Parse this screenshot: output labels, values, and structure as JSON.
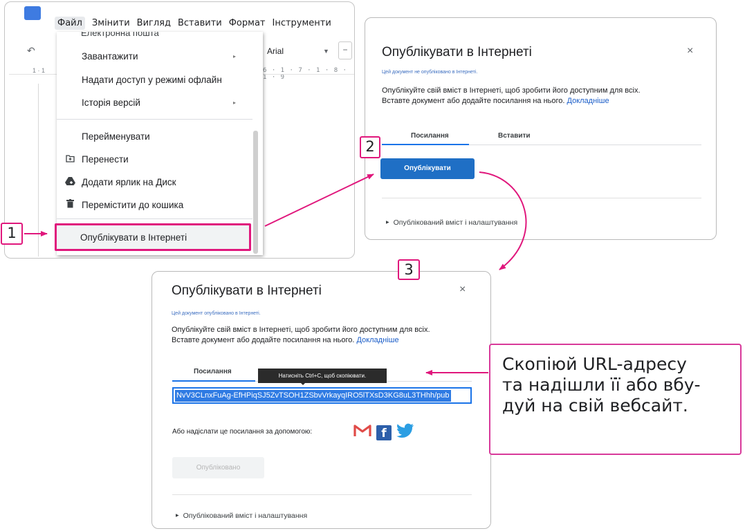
{
  "panel1": {
    "menubar": [
      "Файл",
      "Змінити",
      "Вигляд",
      "Вставити",
      "Формат",
      "Інструменти"
    ],
    "toolbar": {
      "font": "Arial",
      "zoom_minus": "−"
    },
    "ruler": "6 · 1 · 7 · 1 · 8 · 1 · 9",
    "ruler_left": "1 · 1",
    "menu_cut_item": "Електронна пошта",
    "menu_items": [
      {
        "label": "Завантажити",
        "submenu": "▸"
      },
      {
        "label": "Надати доступ у режимі офлайн"
      },
      {
        "label": "Історія версій",
        "submenu": "▸"
      },
      {
        "label": "Перейменувати"
      },
      {
        "label": "Перенести",
        "icon": "folder-move-icon"
      },
      {
        "label": "Додати ярлик на Диск",
        "icon": "drive-shortcut-icon"
      },
      {
        "label": "Перемістити до кошика",
        "icon": "trash-icon"
      }
    ],
    "publish_item": "Опублікувати в Інтернеті",
    "step": "1"
  },
  "panel2": {
    "title": "Опублікувати в Інтернеті",
    "close": "×",
    "status": "Цей документ не опубліковано в Інтернеті.",
    "desc_line1": "Опублікуйте свій вміст в Інтернеті, щоб зробити його доступним для всіх.",
    "desc_line2": "Вставте документ або додайте посилання на нього.",
    "learn_more": "Докладніше",
    "tab_link": "Посилання",
    "tab_embed": "Вставити",
    "publish_button": "Опублікувати",
    "expander": "Опублікований вміст і налаштування",
    "step": "2"
  },
  "panel3": {
    "title": "Опублікувати в Інтернеті",
    "close": "×",
    "status": "Цей документ опубліковано в Інтернеті.",
    "desc_line1": "Опублікуйте свій вміст в Інтернеті, щоб зробити його доступним для всіх.",
    "desc_line2": "Вставте документ або додайте посилання на нього.",
    "learn_more": "Докладніше",
    "tab_link": "Посилання",
    "tooltip": "Натисніть Ctrl+C, щоб скопіювати.",
    "url": "NvV3CLnxFuAg-EfHPiqSJ5ZvTSOH1ZSbvVrkayqIRO5lTXsD3KG8uL3THhh/pub",
    "share_label": "Або надіслати це посилання за допомогою:",
    "share_icons": [
      "gmail-icon",
      "facebook-icon",
      "twitter-icon"
    ],
    "published_button": "Опубліковано",
    "expander": "Опублікований вміст і налаштування",
    "step": "3"
  },
  "callout": {
    "text": "Скопіюй URL-адресу\nта надішли її або вбу-\nдуй на свій вебсайт."
  },
  "colors": {
    "highlight": "#e0177c",
    "publish_button": "#1f6fc5",
    "link": "#1a5dc8",
    "tab_active": "#1a73e8"
  }
}
